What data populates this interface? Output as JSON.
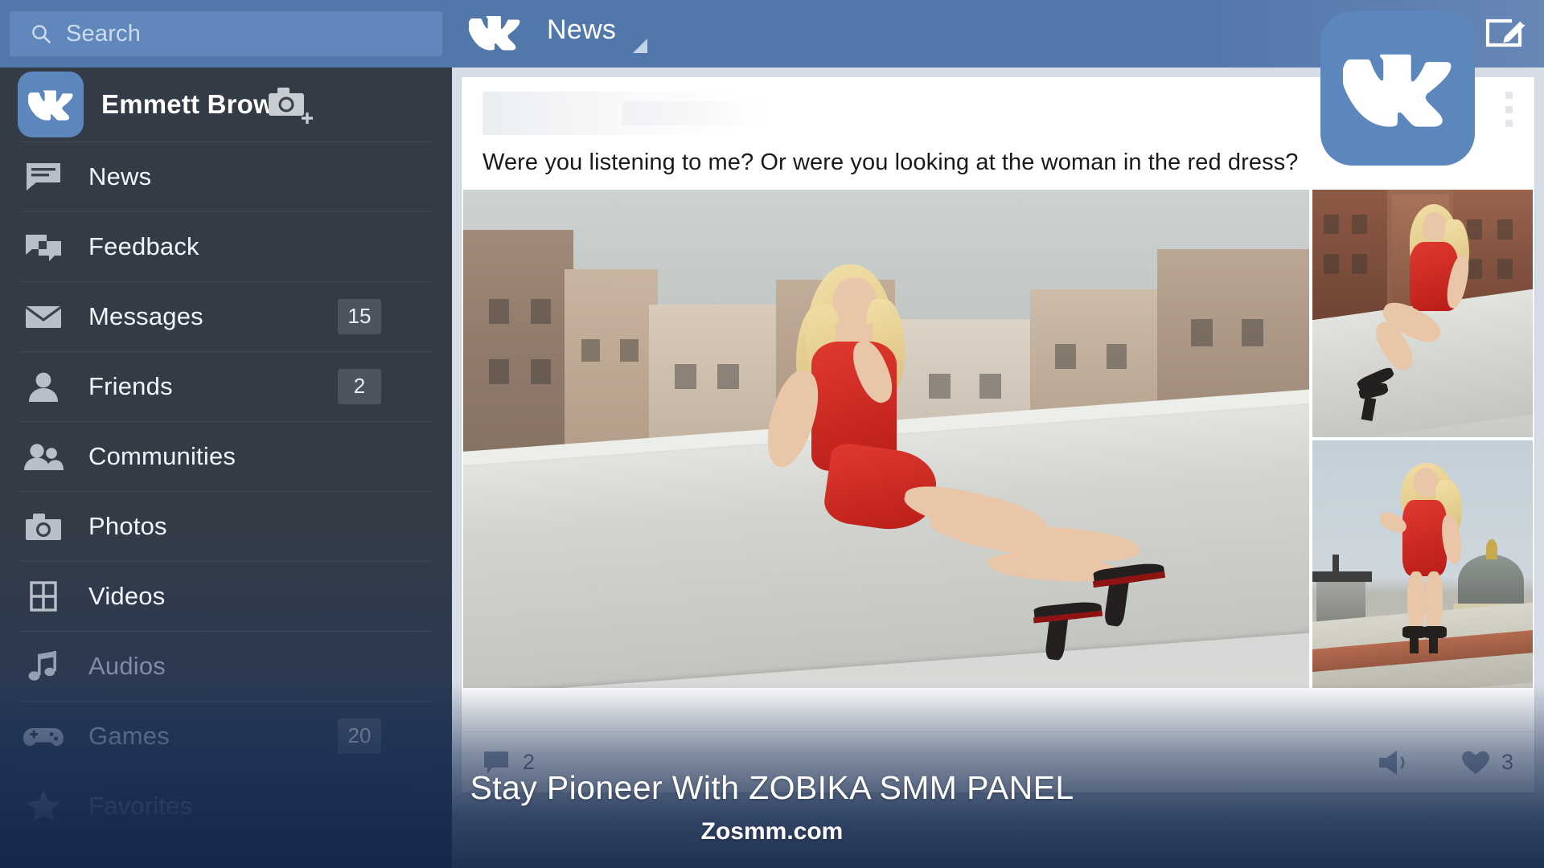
{
  "app": {
    "name": "VK",
    "screen_title": "News"
  },
  "topbar": {
    "search": {
      "placeholder": "Search",
      "value": "",
      "icon": "search-icon"
    },
    "logo_icon": "vk-logo-icon",
    "feed_title": "News",
    "feed_dropdown_icon": "chevron-down-icon",
    "compose_icon": "compose-icon"
  },
  "sidebar": {
    "profile": {
      "name": "Emmett Brown",
      "avatar_icon": "vk-logo-icon",
      "camera_icon": "camera-add-icon"
    },
    "items": [
      {
        "label": "News",
        "icon": "news-icon",
        "badge": "",
        "state": "normal"
      },
      {
        "label": "Feedback",
        "icon": "feedback-icon",
        "badge": "",
        "state": "normal"
      },
      {
        "label": "Messages",
        "icon": "envelope-icon",
        "badge": "15",
        "state": "normal"
      },
      {
        "label": "Friends",
        "icon": "person-icon",
        "badge": "2",
        "state": "normal"
      },
      {
        "label": "Communities",
        "icon": "people-icon",
        "badge": "",
        "state": "normal"
      },
      {
        "label": "Photos",
        "icon": "camera-icon",
        "badge": "",
        "state": "normal"
      },
      {
        "label": "Videos",
        "icon": "video-icon",
        "badge": "",
        "state": "normal"
      },
      {
        "label": "Audios",
        "icon": "music-note-icon",
        "badge": "",
        "state": "dim"
      },
      {
        "label": "Games",
        "icon": "gamepad-icon",
        "badge": "20",
        "state": "dim"
      },
      {
        "label": "Favorites",
        "icon": "star-icon",
        "badge": "",
        "state": "dim2"
      }
    ]
  },
  "post": {
    "text": "Were you listening to me? Or were you looking at the woman in the red dress?",
    "menu_icon": "more-vertical-icon",
    "photos": [
      {
        "alt": "Woman in red dress sitting on a rooftop ledge overlooking city roofs"
      },
      {
        "alt": "Woman in red dress sitting on rooftop, red brick building behind"
      },
      {
        "alt": "Woman in red dress standing on a rooftop with cathedral dome behind"
      }
    ],
    "actions": {
      "comment_icon": "comment-icon",
      "comment_count": "2",
      "share_icon": "share-icon",
      "like_icon": "heart-icon",
      "like_count": "3"
    }
  },
  "overlay": {
    "vk_badge_icon": "vk-logo-icon",
    "watermark_main": "Stay Pioneer With ZOBIKA SMM PANEL",
    "watermark_sub": "Zosmm.com"
  },
  "colors": {
    "brand_blue": "#5b87bd",
    "topbar_blue": "#5277ab",
    "sidebar_dark": "#333b47",
    "sidebar_bottom": "#14294f",
    "feed_bg": "#d6dde6",
    "dress_red": "#d42f28"
  }
}
